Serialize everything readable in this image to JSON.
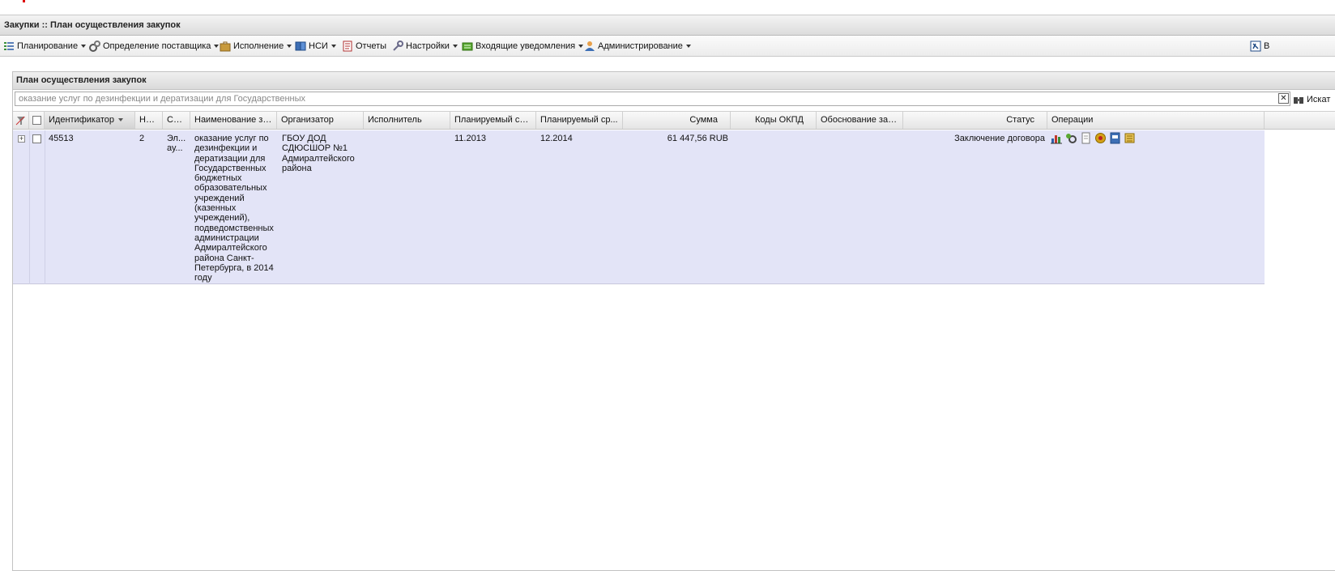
{
  "app": {
    "title": "Закупки :: План осуществления закупок"
  },
  "menu": [
    {
      "label": "Планирование",
      "has_dropdown": true,
      "icon": "list-icon"
    },
    {
      "label": "Определение поставщика",
      "has_dropdown": true,
      "icon": "gears-icon"
    },
    {
      "label": "Исполнение",
      "has_dropdown": true,
      "icon": "briefcase-icon"
    },
    {
      "label": "НСИ",
      "has_dropdown": true,
      "icon": "book-icon"
    },
    {
      "label": "Отчеты",
      "has_dropdown": false,
      "icon": "report-icon"
    },
    {
      "label": "Настройки",
      "has_dropdown": true,
      "icon": "wrench-icon"
    },
    {
      "label": "Входящие уведомления",
      "has_dropdown": true,
      "icon": "notification-icon"
    },
    {
      "label": "Администрирование",
      "has_dropdown": true,
      "icon": "user-icon"
    }
  ],
  "menu_right": {
    "label": "В",
    "icon": "exit-icon"
  },
  "panel": {
    "title": "План осуществления закупок",
    "search": {
      "value": "оказание услуг по дезинфекции и дератизации для Государственных",
      "button_label": "Искат"
    }
  },
  "grid": {
    "columns": [
      "Идентификатор",
      "Но...",
      "Сп...",
      "Наименование за...",
      "Организатор",
      "Исполнитель",
      "Планируемый ср...",
      "Планируемый ср...",
      "Сумма",
      "Коды ОКПД",
      "Обоснование зак...",
      "Статус",
      "Операции"
    ],
    "sorted_column": "Идентификатор",
    "rows": [
      {
        "id": "45513",
        "number": "2",
        "method_line1": "Эл...",
        "method_line2": "ау...",
        "name_lines": [
          "оказание услуг по",
          "дезинфекции и",
          "дератизации для",
          "Государственных",
          "бюджетных",
          "образовательных",
          "учреждений",
          "(казенных",
          "учреждений),",
          "подведомственных",
          "администрации",
          "Адмиралтейского",
          "района Санкт-",
          "Петербурга, в 2014",
          "году"
        ],
        "organizer_lines": [
          "ГБОУ ДОД",
          "СДЮСШОР №1",
          "Адмиралтейского",
          "района"
        ],
        "executor": "",
        "planned_start": "11.2013",
        "planned_end": "12.2014",
        "amount": "61 447,56 RUB",
        "okpd": "",
        "justification": "",
        "status": "Заключение договора",
        "operations": [
          "chart-icon",
          "settings-icon",
          "document-icon",
          "emblem-icon",
          "file-icon",
          "scroll-icon"
        ]
      }
    ]
  }
}
